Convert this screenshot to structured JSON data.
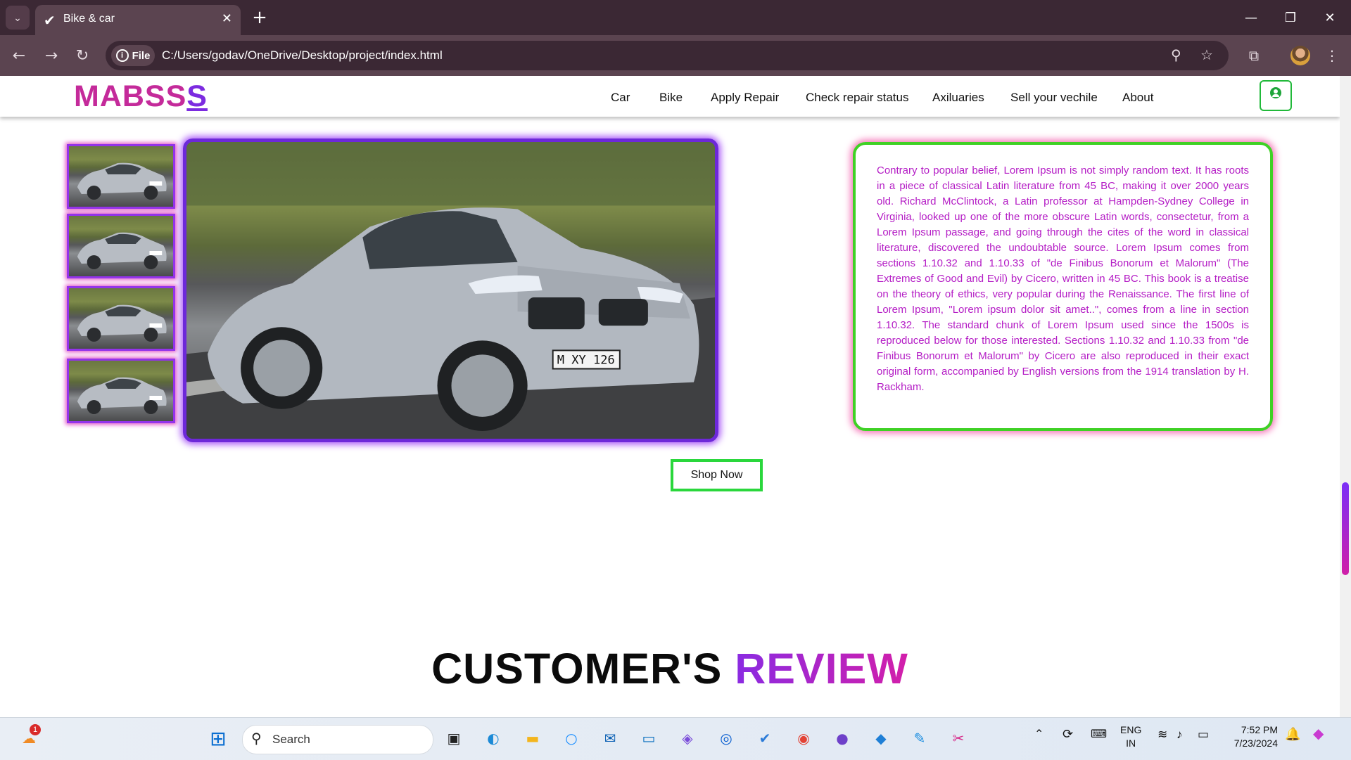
{
  "browser": {
    "tab_title": "Bike & car",
    "file_chip": "File",
    "url": "C:/Users/godav/OneDrive/Desktop/project/index.html"
  },
  "site": {
    "logo_main": "MABSS",
    "logo_last": "S",
    "nav": [
      "Car",
      "Bike",
      "Apply Repair",
      "Check repair status",
      "Axiluaries",
      "Sell your vechile",
      "About"
    ],
    "description": "Contrary to popular belief, Lorem Ipsum is not simply random text. It has roots in a piece of classical Latin literature from 45 BC, making it over 2000 years old. Richard McClintock, a Latin professor at Hampden-Sydney College in Virginia, looked up one of the more obscure Latin words, consectetur, from a Lorem Ipsum passage, and going through the cites of the word in classical literature, discovered the undoubtable source. Lorem Ipsum comes from sections 1.10.32 and 1.10.33 of \"de Finibus Bonorum et Malorum\" (The Extremes of Good and Evil) by Cicero, written in 45 BC. This book is a treatise on the theory of ethics, very popular during the Renaissance. The first line of Lorem Ipsum, \"Lorem ipsum dolor sit amet..\", comes from a line in section 1.10.32. The standard chunk of Lorem Ipsum used since the 1500s is reproduced below for those interested. Sections 1.10.32 and 1.10.33 from \"de Finibus Bonorum et Malorum\" by Cicero are also reproduced in their exact original form, accompanied by English versions from the 1914 translation by H. Rackham.",
    "plate": "M XY 126",
    "shop_button": "Shop Now",
    "review_title_dark": "CUSTOMER'S",
    "review_title_accent": "REVIEW"
  },
  "taskbar": {
    "search_label": "Search",
    "weather_badge": "1",
    "lang_top": "ENG",
    "lang_bottom": "IN",
    "time": "7:52 PM",
    "date": "7/23/2024"
  },
  "colors": {
    "logo": "#c42a9a",
    "accent_purple": "#6d28d9",
    "accent_green": "#3fd125",
    "text_magenta": "#b41cc5"
  }
}
